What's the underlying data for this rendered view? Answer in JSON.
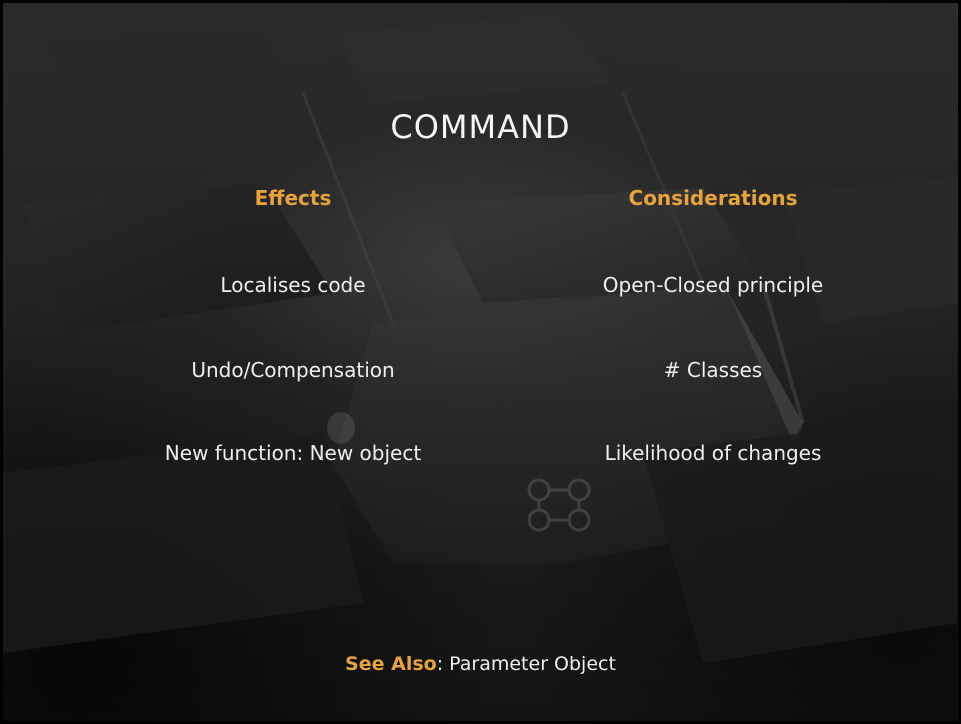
{
  "slide": {
    "title": "COMMAND",
    "effects": {
      "heading": "Effects",
      "items": [
        "Localises code",
        "Undo/Compensation",
        "New function: New object"
      ]
    },
    "considerations": {
      "heading": "Considerations",
      "items": [
        "Open-Closed principle",
        "# Classes",
        "Likelihood of changes"
      ]
    },
    "see_also": {
      "label": "See Also",
      "separator": ": ",
      "value": "Parameter Object"
    }
  },
  "colors": {
    "accent": "#e8a33a",
    "text": "#efefef",
    "background": "#1e1e1e"
  }
}
